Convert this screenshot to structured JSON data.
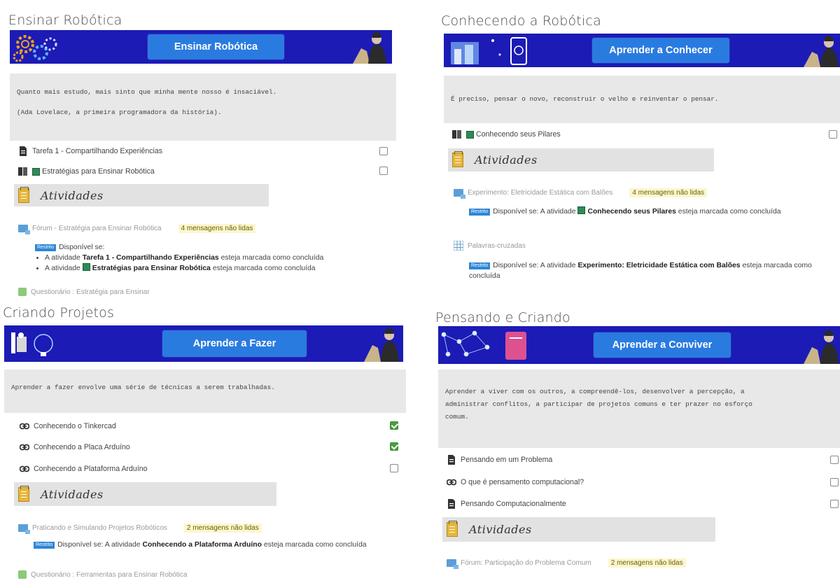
{
  "sections": {
    "s1": {
      "title": "Ensinar Robótica",
      "banner_button": "Ensinar Robótica",
      "quote_lines": [
        "Quanto mais estudo, mais sinto que minha mente nosso é insaciável.",
        "(Ada Lovelace, a primeira programadora da história)."
      ],
      "items": [
        {
          "label": "Tarefa 1 - Compartilhando Experiências",
          "icon": "document-icon",
          "done": false
        },
        {
          "label": "Estratégias para Ensinar Robótica",
          "icon": "book-icon",
          "done": false
        }
      ],
      "activities_label": "Atividades",
      "forum": {
        "label": "Fórum - Estratégia para Ensinar Robótica",
        "badge": "4 mensagens não lidas"
      },
      "restriction": {
        "tag": "Restrito",
        "intro": "Disponível se:",
        "conditions": [
          {
            "prefix": "A atividade",
            "name": "Tarefa 1 - Compartilhando Experiências",
            "suffix": "esteja marcada como concluída"
          },
          {
            "prefix": "A atividade",
            "name": "Estratégias para Ensinar Robótica",
            "suffix": "esteja marcada como concluída"
          }
        ]
      },
      "quiz": "Questionário : Estratégia para Ensinar"
    },
    "s2": {
      "title": "Conhecendo a Robótica",
      "banner_button": "Aprender a Conhecer",
      "quote_lines": [
        "É preciso, pensar o novo, reconstruir o velho e reinventar o pensar."
      ],
      "items": [
        {
          "label": "Conhecendo seus Pilares",
          "icon": "book-icon",
          "done": false
        }
      ],
      "activities_label": "Atividades",
      "forum": {
        "label": "Experimento: Eletricidade Estática com Balões",
        "badge": "4 mensagens não lidas"
      },
      "restriction1": {
        "tag": "Restrito",
        "prefix": "Disponível se: A atividade",
        "name": "Conhecendo seus Pilares",
        "suffix": "esteja marcada como concluída"
      },
      "crossword": "Palavras-cruzadas",
      "restriction2": {
        "tag": "Restrito",
        "prefix": "Disponível se: A atividade",
        "name": "Experimento: Eletricidade Estática com Balões",
        "suffix": "esteja marcada como concluída"
      }
    },
    "s3": {
      "title": "Criando Projetos",
      "banner_button": "Aprender a Fazer",
      "quote_lines": [
        "Aprender a fazer envolve uma série de técnicas a serem trabalhadas."
      ],
      "items": [
        {
          "label": "Conhecendo o Tinkercad",
          "icon": "link-icon",
          "done": true
        },
        {
          "label": "Conhecendo a Placa Arduíno",
          "icon": "link-icon",
          "done": true
        },
        {
          "label": "Conhecendo a Plataforma Arduíno",
          "icon": "link-icon",
          "done": false
        }
      ],
      "activities_label": "Atividades",
      "forum": {
        "label": "Praticando e Simulando Projetos Robóticos",
        "badge": "2 mensagens não lidas"
      },
      "restriction": {
        "tag": "Restrito",
        "prefix": "Disponível se: A atividade",
        "name": "Conhecendo a Plataforma Arduíno",
        "suffix": "esteja marcada como concluída"
      },
      "quiz": "Questionário : Ferramentas para Ensinar Robótica"
    },
    "s4": {
      "title": "Pensando e Criando",
      "banner_button": "Aprender a Conviver",
      "quote_lines": [
        "Aprender a viver com os outros, a compreendê-los, desenvolver a percepção, a",
        "administrar conflitos, a participar de projetos comuns e ter prazer no esforço",
        "comum."
      ],
      "items": [
        {
          "label": "Pensando em um Problema",
          "icon": "document-icon",
          "done": false
        },
        {
          "label": "O que é pensamento computacional?",
          "icon": "link-icon",
          "done": false
        },
        {
          "label": "Pensando Computacionalmente",
          "icon": "document-icon",
          "done": false
        }
      ],
      "activities_label": "Atividades",
      "forum": {
        "label": "Fórum: Participação do Problema Comum",
        "badge": "2 mensagens não lidas"
      }
    }
  }
}
